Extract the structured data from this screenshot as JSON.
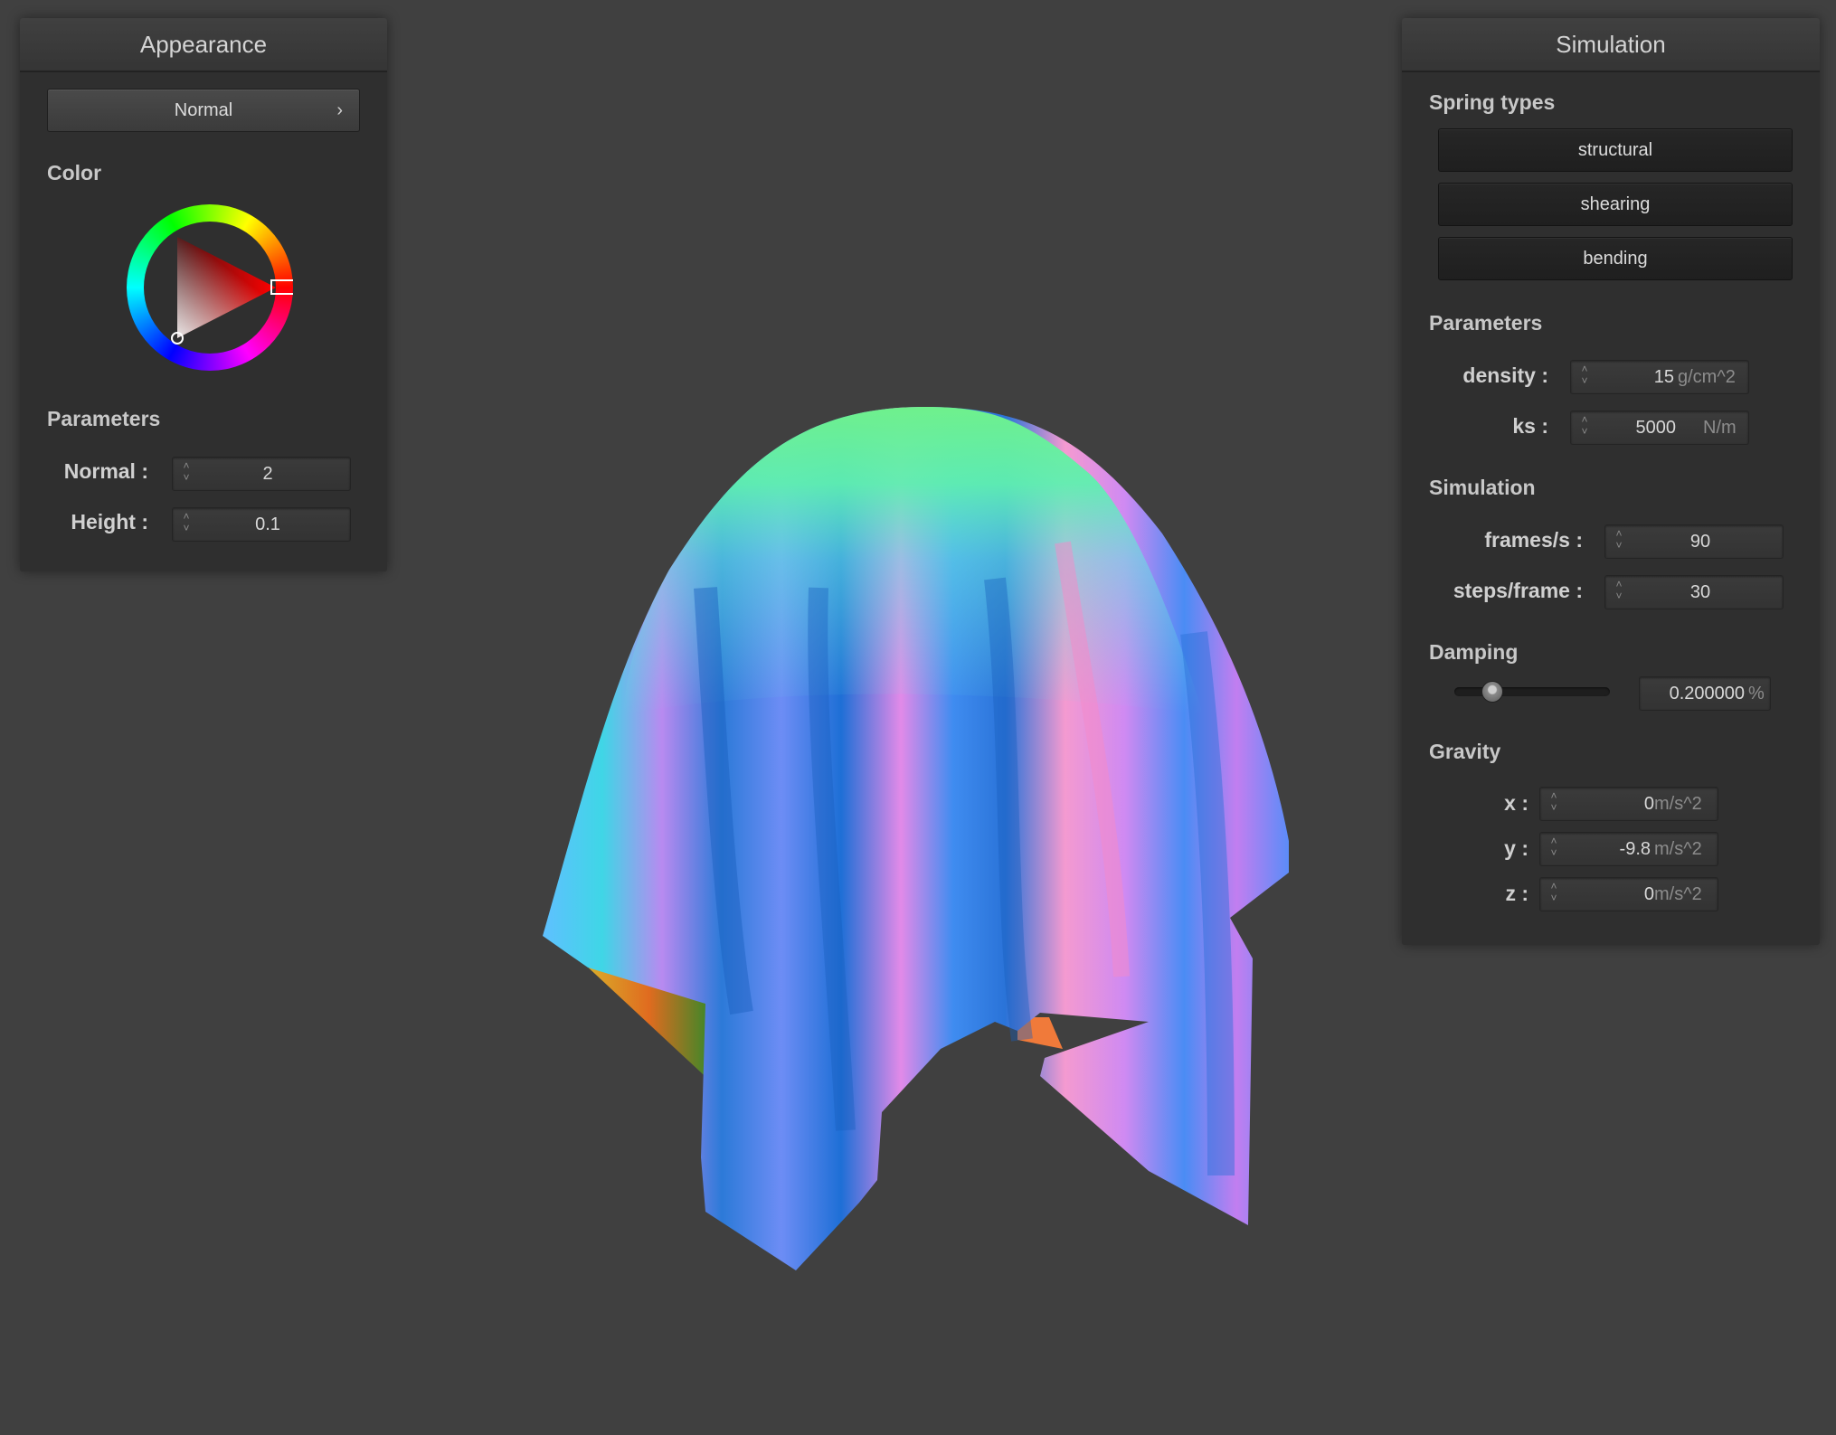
{
  "appearance": {
    "title": "Appearance",
    "shader_popup": "Normal",
    "shader_popup_icon": "chevron-right-icon",
    "color_label": "Color",
    "color_value": "#ff0000",
    "parameters_label": "Parameters",
    "normal_label": "Normal :",
    "normal_value": "2",
    "height_label": "Height :",
    "height_value": "0.1"
  },
  "simulation": {
    "title": "Simulation",
    "spring_types_label": "Spring types",
    "spring_types": [
      "structural",
      "shearing",
      "bending"
    ],
    "parameters_label": "Parameters",
    "density_label": "density :",
    "density_value": "15",
    "density_unit": "g/cm^2",
    "ks_label": "ks :",
    "ks_value": "5000",
    "ks_unit": "N/m",
    "simulation_label": "Simulation",
    "fps_label": "frames/s :",
    "fps_value": "90",
    "steps_label": "steps/frame :",
    "steps_value": "30",
    "damping_label": "Damping",
    "damping_value": "0.200000",
    "damping_unit": "%",
    "damping_slider_fraction": 0.2,
    "gravity_label": "Gravity",
    "gravity_x_label": "x :",
    "gravity_x_value": "0",
    "gravity_y_label": "y :",
    "gravity_y_value": "-9.8",
    "gravity_z_label": "z :",
    "gravity_z_value": "0",
    "gravity_unit": "m/s^2"
  }
}
